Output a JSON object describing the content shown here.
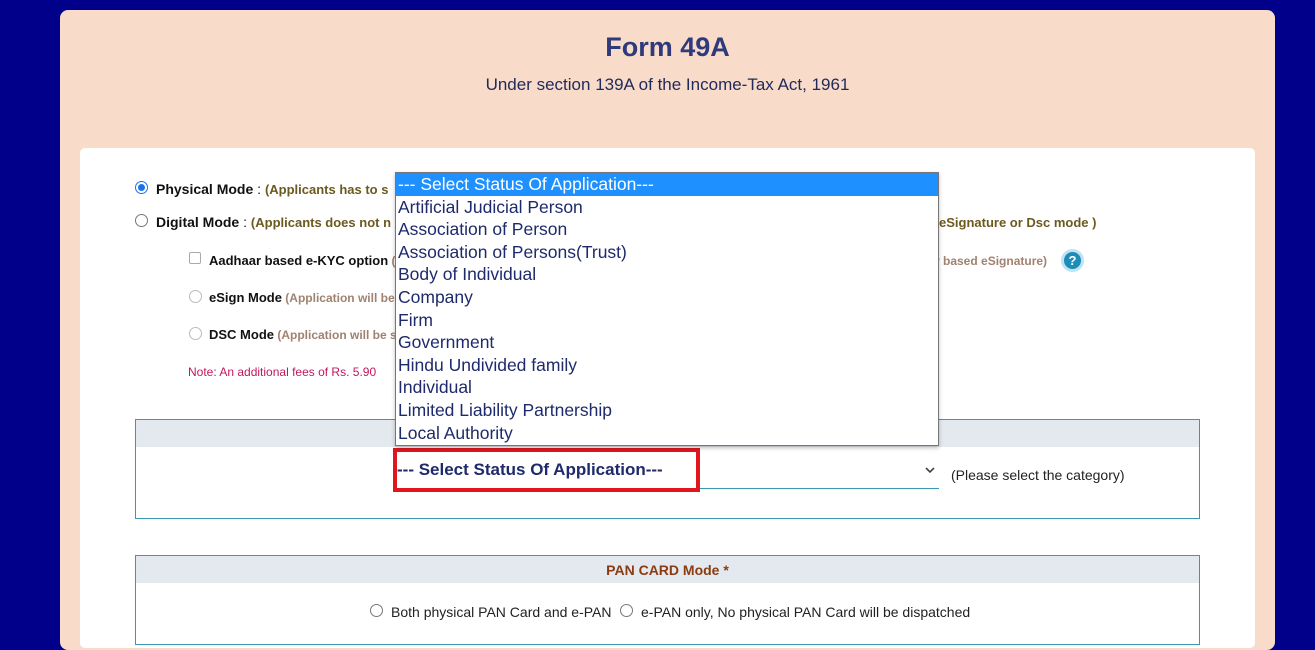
{
  "header": {
    "title": "Form 49A",
    "subtitle": "Under section 139A of the Income-Tax Act, 1961"
  },
  "modes": {
    "physical": {
      "label": "Physical Mode",
      "sep": " : ",
      "note": "(Applicants has to s",
      "selected": true
    },
    "digital": {
      "label": "Digital Mode",
      "sep": " : ",
      "note": "(Applicants does not n",
      "note_right": "eSignature or Dsc mode )",
      "selected": false
    },
    "aadhaar": {
      "label": "Aadhaar based e-KYC option",
      "note": " (",
      "note_right": "r based eSignature)"
    },
    "esign": {
      "label": "eSign Mode",
      "note": " (Application will be"
    },
    "dsc": {
      "label": "DSC Mode",
      "note": " (Application will be s"
    },
    "fee_note": "Note: An additional fees of Rs. 5.90",
    "help_icon": "?"
  },
  "status_select": {
    "value": "--- Select Status Of Application---",
    "hint": "(Please select the category)",
    "options": [
      "--- Select Status Of Application---",
      "Artificial Judicial Person",
      "Association of Person",
      "Association of Persons(Trust)",
      "Body of Individual",
      "Company",
      "Firm",
      "Government",
      "Hindu Undivided family",
      "Individual",
      "Limited Liability Partnership",
      "Local Authority"
    ],
    "selected_index": 0
  },
  "pan_card_mode": {
    "heading": "PAN CARD Mode *",
    "options": [
      "Both physical PAN Card and e-PAN",
      "e-PAN only, No physical PAN Card will be dispatched"
    ]
  },
  "colors": {
    "page_bg": "#00008b",
    "card_bg": "#f8dbc8",
    "accent": "#1a73e8",
    "highlight": "#e0151e",
    "dropdown_selected": "#1e90ff"
  }
}
